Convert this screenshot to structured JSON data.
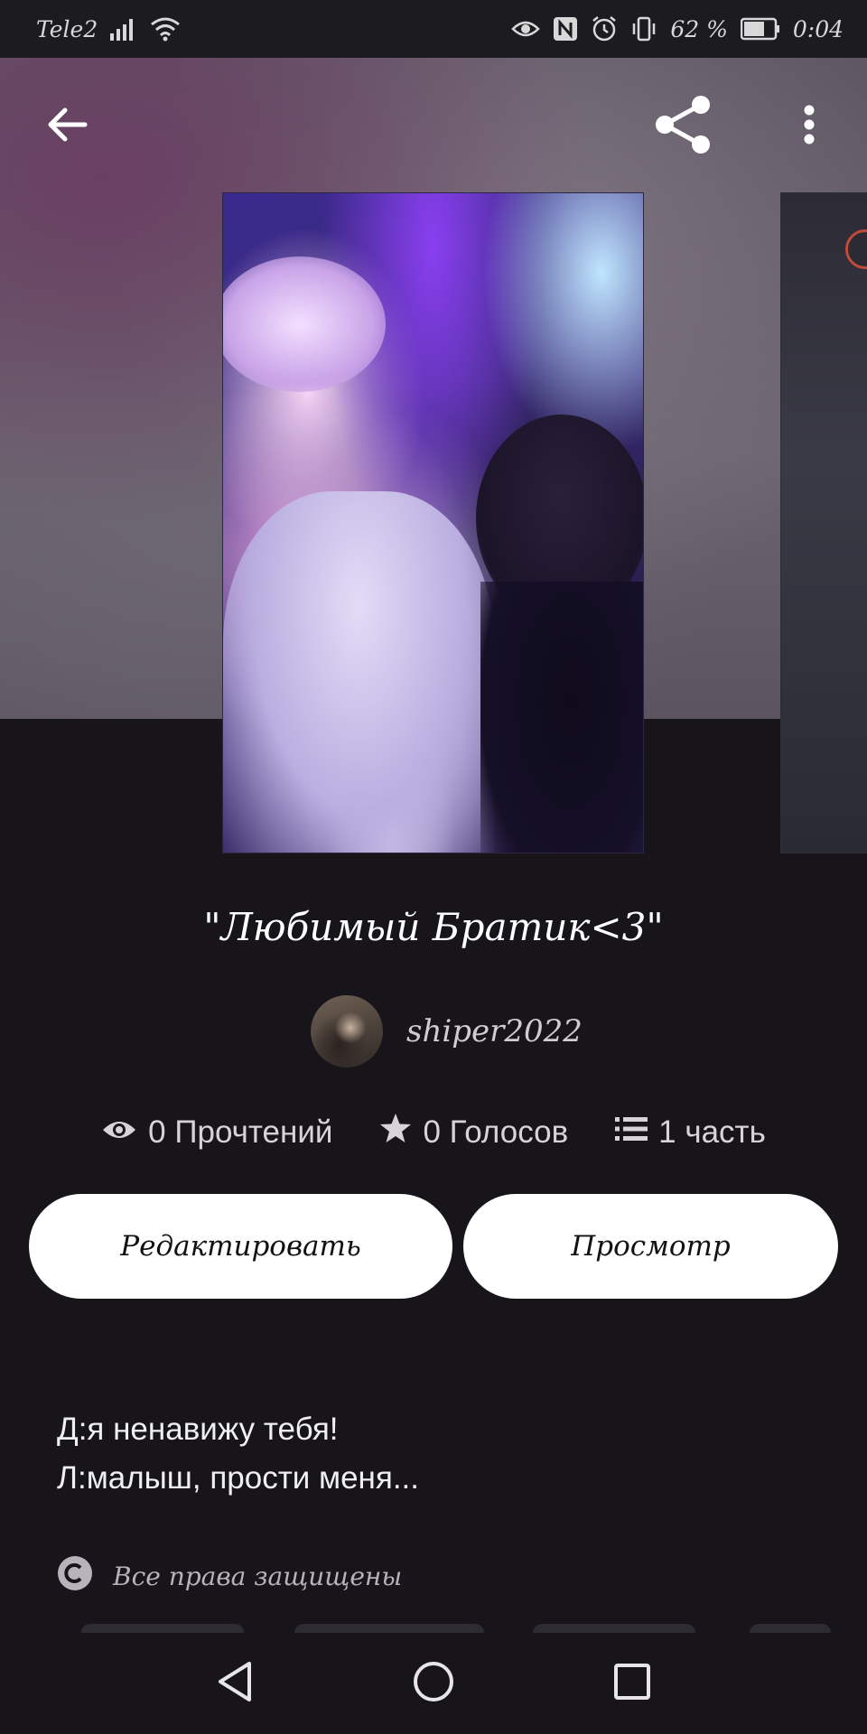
{
  "status_bar": {
    "carrier": "Tele2",
    "battery": "62 %",
    "time": "0:04"
  },
  "header": {
    "back_icon": "arrow-left-icon",
    "share_icon": "share-icon",
    "more_icon": "more-vertical-icon"
  },
  "story": {
    "title": "\"Любимый Братик<3\"",
    "author": "shiper2022",
    "stats": {
      "reads": "0 Прочтений",
      "votes": "0 Голосов",
      "parts": "1 часть"
    },
    "description_lines": [
      "Д:я ненавижу тебя!",
      "Л:малыш, прости меня..."
    ],
    "copyright": "Все права защищены"
  },
  "actions": {
    "edit_label": "Редактировать",
    "preview_label": "Просмотр"
  },
  "colors": {
    "background": "#17151a",
    "button": "#ffffff",
    "text": "#ffffff"
  }
}
